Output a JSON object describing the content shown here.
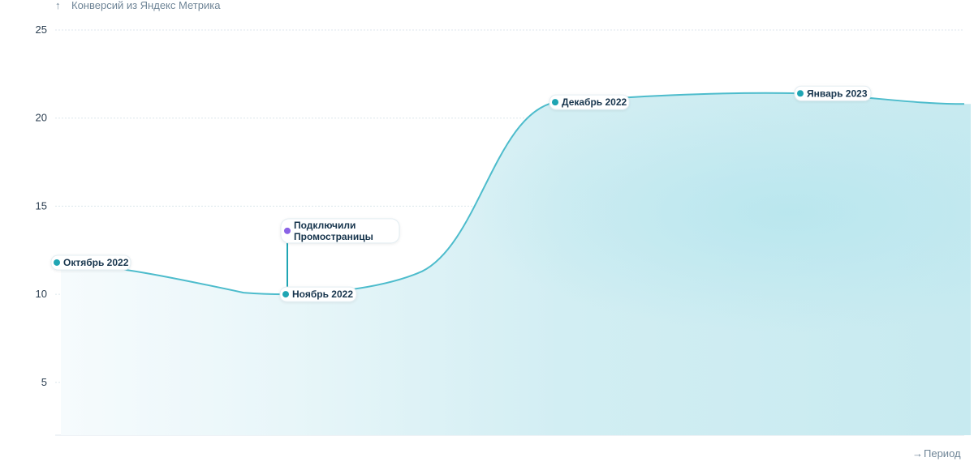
{
  "chart_data": {
    "type": "area",
    "y_axis_label": "Конверсий из Яндекс Метрика",
    "x_axis_label": "Период",
    "ylim": [
      2,
      25
    ],
    "y_ticks": [
      5,
      10,
      15,
      20,
      25
    ],
    "grid": true,
    "series": [
      {
        "values": [
          11.8,
          10,
          20.9,
          21.4,
          20.8
        ]
      }
    ],
    "x": [
      "Октябрь 2022",
      "Ноябрь 2022",
      "Декабрь 2022",
      "Январь 2023",
      ""
    ],
    "labeled_points": [
      {
        "label": "Октябрь 2022",
        "value": 11.8
      },
      {
        "label": "Ноябрь 2022",
        "value": 10
      },
      {
        "label": "Декабрь 2022",
        "value": 20.9
      },
      {
        "label": "Январь 2023",
        "value": 21.4
      }
    ],
    "annotations": [
      {
        "text_line1": "Подключили",
        "text_line2": "Промостраницы",
        "attached_to": "Ноябрь 2022",
        "value": 13.6
      }
    ],
    "colors": {
      "line": "#4dbccc",
      "point": "#1fa5b3",
      "annotation_point": "#8a63e6",
      "grid": "#dce6ec"
    }
  }
}
